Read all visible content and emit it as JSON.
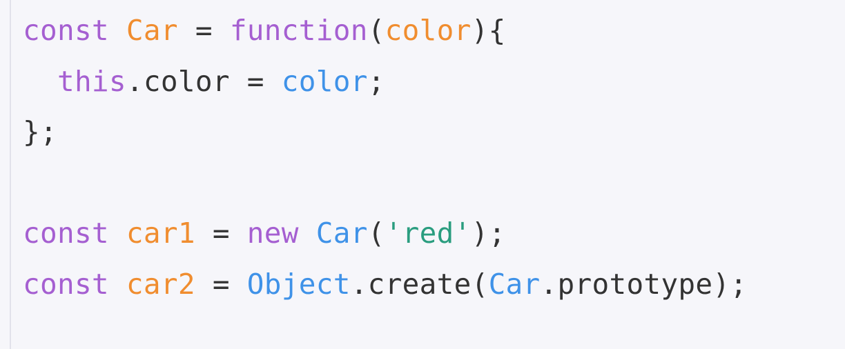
{
  "code": {
    "colors": {
      "keyword": "#a55fd1",
      "variable": "#f08d2f",
      "identifier": "#3f92e8",
      "string": "#2a9d7f",
      "plain": "#333333",
      "background": "#f6f6fa"
    },
    "lines": [
      [
        {
          "t": "const",
          "c": "kw"
        },
        {
          "t": " ",
          "c": "plain"
        },
        {
          "t": "Car",
          "c": "var"
        },
        {
          "t": " = ",
          "c": "plain"
        },
        {
          "t": "function",
          "c": "kw"
        },
        {
          "t": "(",
          "c": "plain"
        },
        {
          "t": "color",
          "c": "var"
        },
        {
          "t": "){",
          "c": "plain"
        }
      ],
      [
        {
          "t": "  ",
          "c": "plain"
        },
        {
          "t": "this",
          "c": "kw"
        },
        {
          "t": ".color = ",
          "c": "plain"
        },
        {
          "t": "color",
          "c": "fn"
        },
        {
          "t": ";",
          "c": "plain"
        }
      ],
      [
        {
          "t": "};",
          "c": "plain"
        }
      ],
      [],
      [
        {
          "t": "const",
          "c": "kw"
        },
        {
          "t": " ",
          "c": "plain"
        },
        {
          "t": "car1",
          "c": "var"
        },
        {
          "t": " = ",
          "c": "plain"
        },
        {
          "t": "new",
          "c": "kw"
        },
        {
          "t": " ",
          "c": "plain"
        },
        {
          "t": "Car",
          "c": "fn"
        },
        {
          "t": "(",
          "c": "plain"
        },
        {
          "t": "'red'",
          "c": "str"
        },
        {
          "t": ");",
          "c": "plain"
        }
      ],
      [
        {
          "t": "const",
          "c": "kw"
        },
        {
          "t": " ",
          "c": "plain"
        },
        {
          "t": "car2",
          "c": "var"
        },
        {
          "t": " = ",
          "c": "plain"
        },
        {
          "t": "Object",
          "c": "fn"
        },
        {
          "t": ".create(",
          "c": "plain"
        },
        {
          "t": "Car",
          "c": "fn"
        },
        {
          "t": ".prototype);",
          "c": "plain"
        }
      ]
    ]
  }
}
